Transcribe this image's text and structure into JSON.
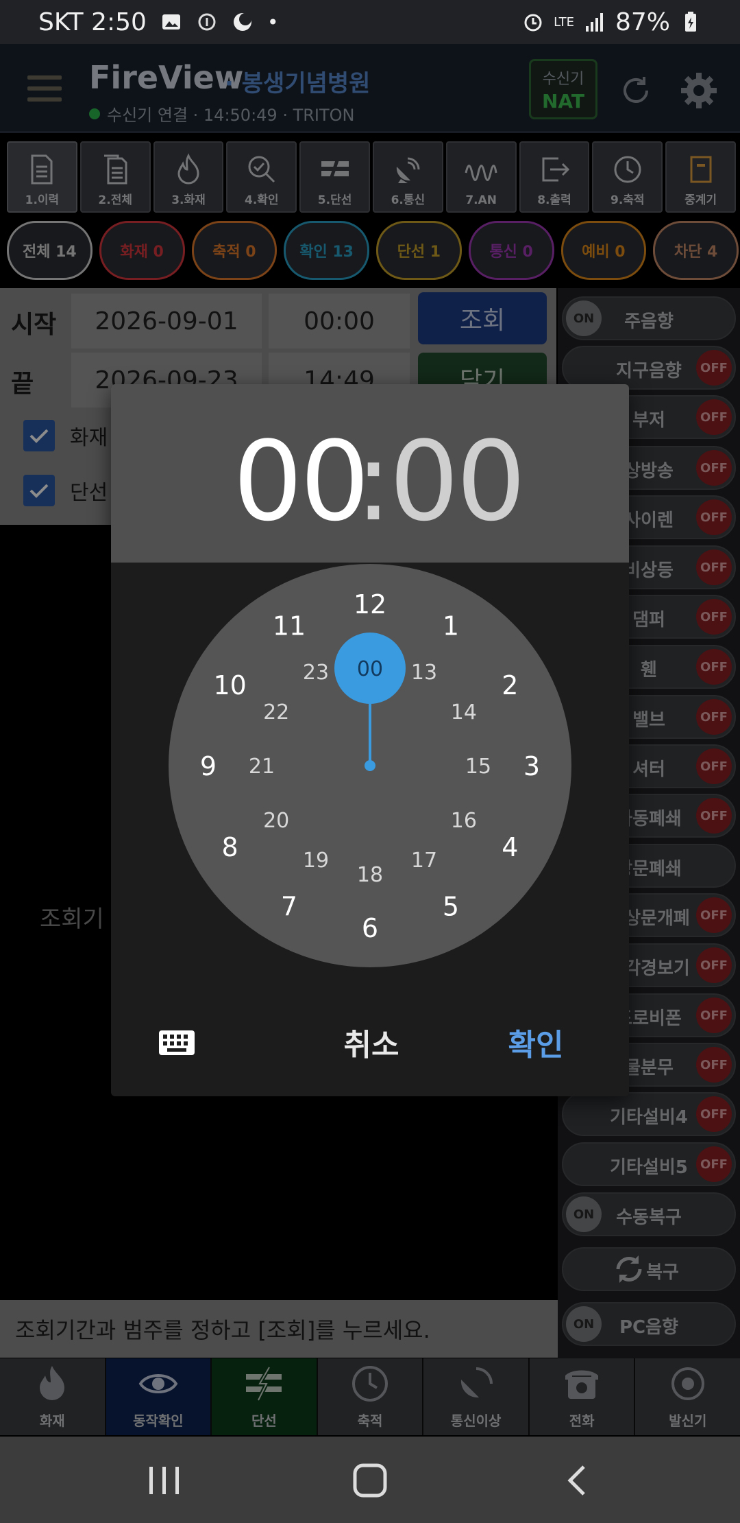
{
  "status_bar": {
    "carrier_time": "SKT 2:50",
    "lte": "LTE",
    "battery": "87%"
  },
  "header": {
    "title": "FireView",
    "subtitle": "· 봉생기념병원",
    "connection": "수신기 연결 · 14:50:49 · TRITON",
    "receiver_label": "수신기",
    "receiver_value": "NAT"
  },
  "toolbar": [
    {
      "label": "1.이력",
      "icon": "document-icon"
    },
    {
      "label": "2.전체",
      "icon": "documents-icon"
    },
    {
      "label": "3.화재",
      "icon": "fire-icon"
    },
    {
      "label": "4.확인",
      "icon": "search-check-icon"
    },
    {
      "label": "5.단선",
      "icon": "broken-line-icon"
    },
    {
      "label": "6.통신",
      "icon": "satellite-icon"
    },
    {
      "label": "7.AN",
      "icon": "wave-icon"
    },
    {
      "label": "8.출력",
      "icon": "output-icon"
    },
    {
      "label": "9.축적",
      "icon": "clock-icon"
    },
    {
      "label": "중계기",
      "icon": "repeater-icon"
    }
  ],
  "chips": [
    {
      "label": "전체 14",
      "color": "#d6d6d6"
    },
    {
      "label": "화재 0",
      "color": "#d9383f"
    },
    {
      "label": "축적 0",
      "color": "#e07a2a"
    },
    {
      "label": "확인 13",
      "color": "#2aa3c9"
    },
    {
      "label": "단선 1",
      "color": "#c9a22a"
    },
    {
      "label": "통신 0",
      "color": "#a03ab8"
    },
    {
      "label": "예비 0",
      "color": "#e08a1a"
    },
    {
      "label": "차단 4",
      "color": "#c98a6a"
    }
  ],
  "query": {
    "start_label": "시작",
    "start_date": "2026-09-01",
    "start_time": "00:00",
    "end_label": "끝",
    "end_date": "2026-09-23",
    "end_time": "14:49",
    "search_button": "조회",
    "close_button": "닫기",
    "check1": "화재",
    "check2": "단선",
    "empty_hint": "조회기간과 범주를 정하고 [조회]를 누르세요.",
    "empty_short": "조회기"
  },
  "switches": [
    {
      "label": "주음향",
      "state": "ON"
    },
    {
      "label": "지구음향",
      "state": "OFF"
    },
    {
      "label": "부저",
      "state": "OFF"
    },
    {
      "label": "상방송",
      "state": "OFF"
    },
    {
      "label": "사이렌",
      "state": "OFF"
    },
    {
      "label": "비상등",
      "state": "OFF"
    },
    {
      "label": "댐퍼",
      "state": "OFF"
    },
    {
      "label": "휀",
      "state": "OFF"
    },
    {
      "label": "밸브",
      "state": "OFF"
    },
    {
      "label": "셔터",
      "state": "OFF"
    },
    {
      "label": "자동폐쇄",
      "state": "OFF"
    },
    {
      "label": "방문폐쇄",
      "state": ""
    },
    {
      "label": "비상문개폐",
      "state": "OFF"
    },
    {
      "label": "시각경보기",
      "state": "OFF"
    },
    {
      "label": "도로비폰",
      "state": "OFF"
    },
    {
      "label": "물분무",
      "state": "OFF"
    },
    {
      "label": "기타설비4",
      "state": "OFF"
    },
    {
      "label": "기타설비5",
      "state": "OFF"
    },
    {
      "label": "수동복구",
      "state": "ON"
    },
    {
      "label": "복구",
      "state": "REFRESH"
    },
    {
      "label": "PC음향",
      "state": "ON"
    }
  ],
  "bottom_nav": [
    {
      "label": "화재",
      "icon": "fire-icon"
    },
    {
      "label": "동작확인",
      "icon": "eye-icon"
    },
    {
      "label": "단선",
      "icon": "broken-line-icon"
    },
    {
      "label": "축적",
      "icon": "clock-icon"
    },
    {
      "label": "통신이상",
      "icon": "satellite-question-icon"
    },
    {
      "label": "전화",
      "icon": "phone-icon"
    },
    {
      "label": "발신기",
      "icon": "bell-icon"
    }
  ],
  "time_picker": {
    "hour": "00",
    "colon": ":",
    "minute": "00",
    "outer": [
      "12",
      "1",
      "2",
      "3",
      "4",
      "5",
      "6",
      "7",
      "8",
      "9",
      "10",
      "11"
    ],
    "inner": [
      "00",
      "13",
      "14",
      "15",
      "16",
      "17",
      "18",
      "19",
      "20",
      "21",
      "22",
      "23"
    ],
    "selected": "00",
    "accent": "#3a9be0",
    "cancel": "취소",
    "ok": "확인"
  }
}
